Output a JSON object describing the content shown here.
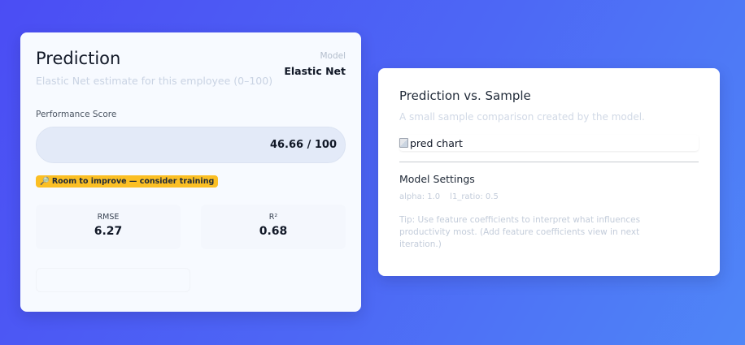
{
  "prediction_card": {
    "title": "Prediction",
    "subtitle": "Elastic Net estimate for this employee (0–100)",
    "model_label": "Model",
    "model_value": "Elastic Net",
    "performance_label": "Performance Score",
    "performance_value": "46.66 / 100",
    "performance_fraction": 0.4666,
    "badge_icon": "🔎",
    "badge_text": "Room to improve — consider training",
    "metrics": [
      {
        "label": "RMSE",
        "value": "6.27"
      },
      {
        "label": "R²",
        "value": "0.68"
      }
    ]
  },
  "chart_card": {
    "title": "Prediction vs. Sample",
    "subtitle": "A small sample comparison created by the model.",
    "chart_alt": "pred chart",
    "settings_title": "Model Settings",
    "settings": {
      "alpha": "alpha: 1.0",
      "l1_ratio": "l1_ratio: 0.5"
    },
    "tip": "Tip: Use feature coefficients to interpret what influences productivity most. (Add feature coefficients view in next iteration.)"
  },
  "colors": {
    "background_start": "#4b4df4",
    "background_end": "#4f86f7",
    "badge": "#fbbf24"
  }
}
